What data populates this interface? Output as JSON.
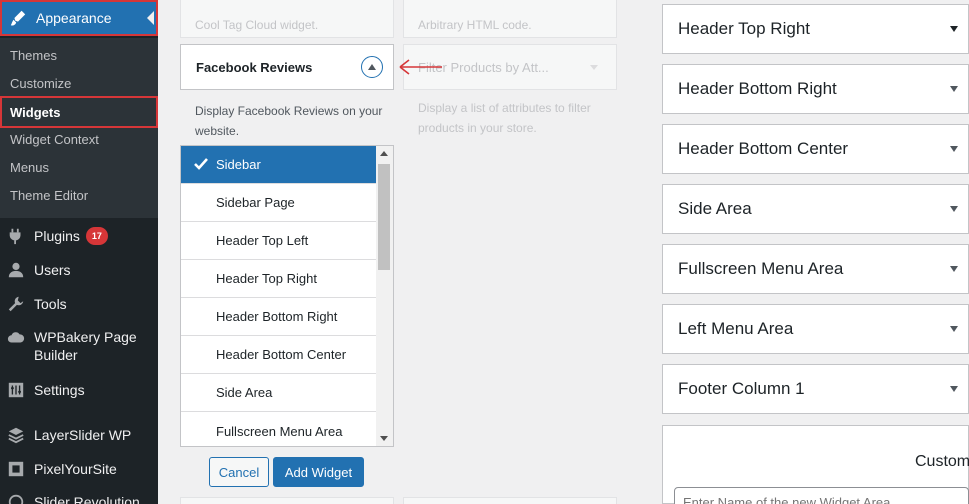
{
  "sidebar": {
    "appearance": "Appearance",
    "submenu": [
      "Themes",
      "Customize",
      "Widgets",
      "Widget Context",
      "Menus",
      "Theme Editor"
    ],
    "active_sub": "Widgets",
    "plugins": "Plugins",
    "plugins_count": "17",
    "users": "Users",
    "tools": "Tools",
    "wpbakery_line1": "WPBakery Page",
    "wpbakery_line2": "Builder",
    "settings": "Settings",
    "layerslider": "LayerSlider WP",
    "pixelyoursite": "PixelYourSite",
    "slider_revolution": "Slider Revolution"
  },
  "widgets": {
    "faded_top_left": "Cool Tag Cloud widget.",
    "faded_top_right": "Arbitrary HTML code.",
    "faded_filter_title": "Filter Products by Att...",
    "faded_filter_desc_1": "Display a list of attributes to filter",
    "faded_filter_desc_2": "products in your store.",
    "fb_title": "Facebook Reviews",
    "fb_desc_1": "Display Facebook Reviews on your",
    "fb_desc_2": "website.",
    "sidebar_options": [
      "Sidebar",
      "Sidebar Page",
      "Header Top Left",
      "Header Top Right",
      "Header Bottom Right",
      "Header Bottom Center",
      "Side Area",
      "Fullscreen Menu Area"
    ],
    "selected_option": "Sidebar",
    "cancel": "Cancel",
    "add_widget": "Add Widget"
  },
  "areas": [
    "Header Top Right",
    "Header Bottom Right",
    "Header Bottom Center",
    "Side Area",
    "Fullscreen Menu Area",
    "Left Menu Area",
    "Footer Column 1"
  ],
  "custom": {
    "title": "Custom",
    "placeholder": "Enter Name of the new Widget Area"
  },
  "colors": {
    "accent": "#2271b1",
    "alert": "#d63638",
    "sidebar_bg": "#1d2327"
  }
}
